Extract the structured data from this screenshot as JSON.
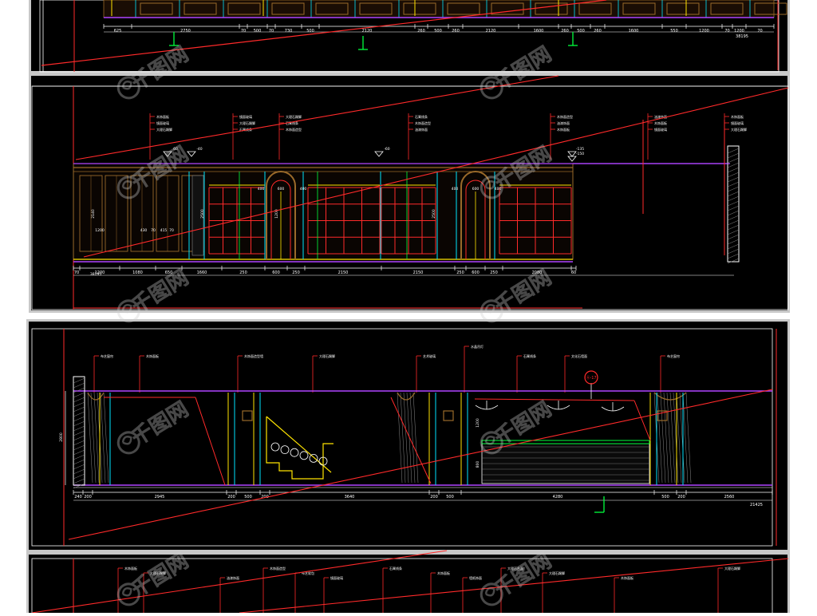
{
  "colors": {
    "page_bg": "#ffffff",
    "panel_bg": "#000000",
    "panel_frame": "#c8c8c8",
    "red": "#ff2a2a",
    "yellow": "#ffe400",
    "cyan": "#00e5ff",
    "green": "#00ff3c",
    "magenta": "#b044ff",
    "white": "#ffffff",
    "wood": "#9a6a2a",
    "gray": "#8a8a8a",
    "watermark": "#cfcfcf"
  },
  "watermark": {
    "text": "千图网",
    "icon": "qiantu-logo-icon"
  },
  "panel1": {
    "dims": [
      "625",
      "2750",
      "70",
      "500",
      "70",
      "730",
      "500",
      "2120",
      "260",
      "500",
      "260",
      "2120",
      "1600",
      "260",
      "500",
      "260",
      "1600",
      "550",
      "1200",
      "70",
      "1200",
      "70"
    ],
    "total": "38195"
  },
  "panel2": {
    "callouts": [
      "木饰面板",
      "镜面玻璃",
      "大理石踢脚",
      "石膏线条",
      "木饰面造型",
      "油漆饰面"
    ],
    "levels": [
      "60",
      "-40",
      "-60",
      "-135",
      "-150"
    ],
    "arch_dims": [
      "400",
      "600",
      "400",
      "400",
      "600",
      "400"
    ],
    "vertical": [
      "2140",
      "2500",
      "1200",
      "2500"
    ],
    "small_dims": [
      "1200",
      "430",
      "70",
      "415",
      "70"
    ],
    "dims": [
      "70",
      "1200",
      "1080",
      "650",
      "1660",
      "250",
      "600",
      "250",
      "2150",
      "2150",
      "250",
      "600",
      "250",
      "2080",
      "60"
    ],
    "total": "38195"
  },
  "panel3": {
    "callouts": [
      "布艺窗帘",
      "木饰面板",
      "木饰面造型墙",
      "大理石踢脚",
      "艺术玻璃",
      "水晶吊灯",
      "石膏线条",
      "文化石墙面"
    ],
    "node": "Ⓐ-17",
    "height": "2800",
    "dims": [
      "240",
      "200",
      "2945",
      "200",
      "500",
      "200",
      "3640",
      "200",
      "500",
      "4280",
      "500",
      "200",
      "2560"
    ],
    "total": "21425",
    "vertical": [
      "1200",
      "800"
    ]
  },
  "panel4": {
    "callouts": [
      "木饰面板",
      "大理石踢脚",
      "油漆饰面",
      "木饰面造型",
      "布艺软包",
      "镜面玻璃",
      "石膏线条",
      "木饰面板",
      "墙纸饰面",
      "大理石台面",
      "大理石踢脚"
    ]
  }
}
